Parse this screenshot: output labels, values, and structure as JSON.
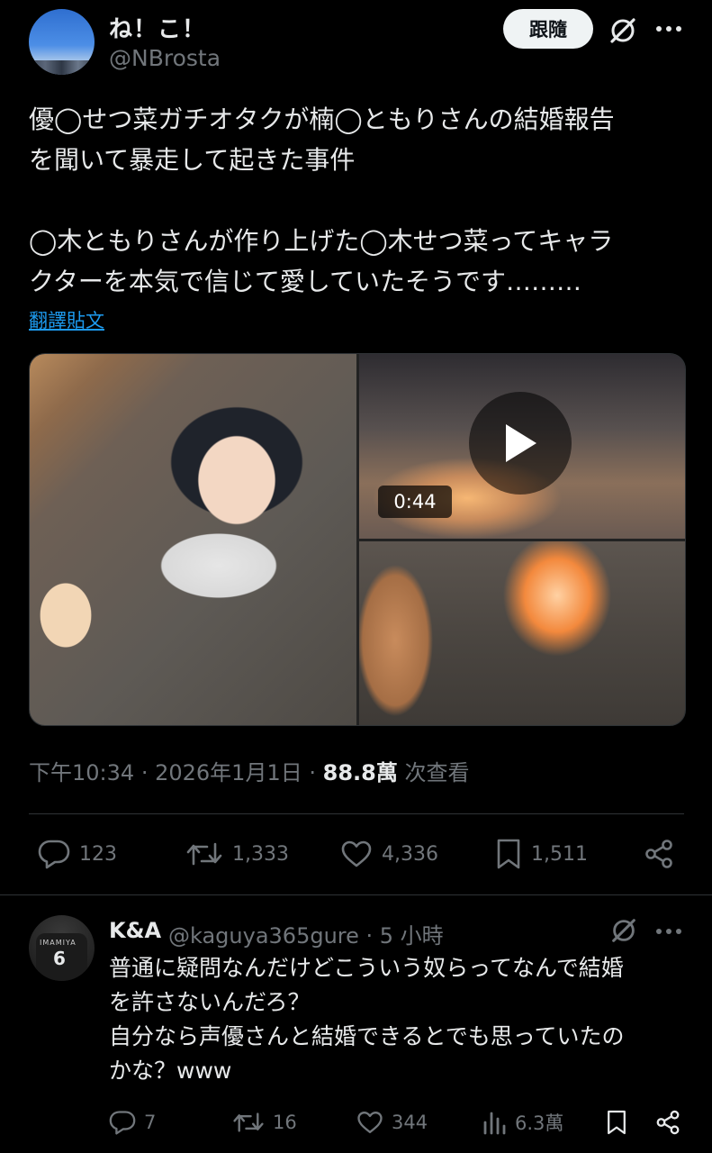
{
  "tweet": {
    "author_name": "ね！こ！",
    "author_handle": "@NBrosta",
    "follow_label": "跟隨",
    "text": "優◯せつ菜ガチオタクが楠◯ともりさんの結婚報告\nを聞いて暴走して起きた事件\n\n◯木ともりさんが作り上げた◯木せつ菜ってキャラ\nクターを本気で信じて愛していたそうです………",
    "translate_label": "翻譯貼文",
    "video_duration": "0:44",
    "time": "下午10:34",
    "date": "2026年1月1日",
    "sep": "·",
    "views_value": "88.8萬",
    "views_label": "次查看",
    "stats": {
      "replies": "123",
      "retweets": "1,333",
      "likes": "4,336",
      "bookmarks": "1,511"
    }
  },
  "reply": {
    "author_name": "K&A",
    "author_handle": "@kaguya365gure · 5 小時",
    "avatar_number": "6",
    "avatar_name": "IMAMIYA",
    "text": "普通に疑問なんだけどこういう奴らってなんで結婚\nを許さないんだろ？\n自分なら声優さんと結婚できるとでも思っていたの\nかな？www",
    "stats": {
      "replies": "7",
      "retweets": "16",
      "likes": "344",
      "views": "6.3萬"
    }
  },
  "icons": [
    "grok-icon",
    "more-icon",
    "play-icon",
    "reply-icon",
    "retweet-icon",
    "like-icon",
    "bookmark-icon",
    "share-icon",
    "views-icon"
  ],
  "colors": {
    "background": "#000000",
    "text": "#e7e9ea",
    "muted": "#71767b",
    "link": "#1d9bf0",
    "divider": "#2f3336"
  }
}
